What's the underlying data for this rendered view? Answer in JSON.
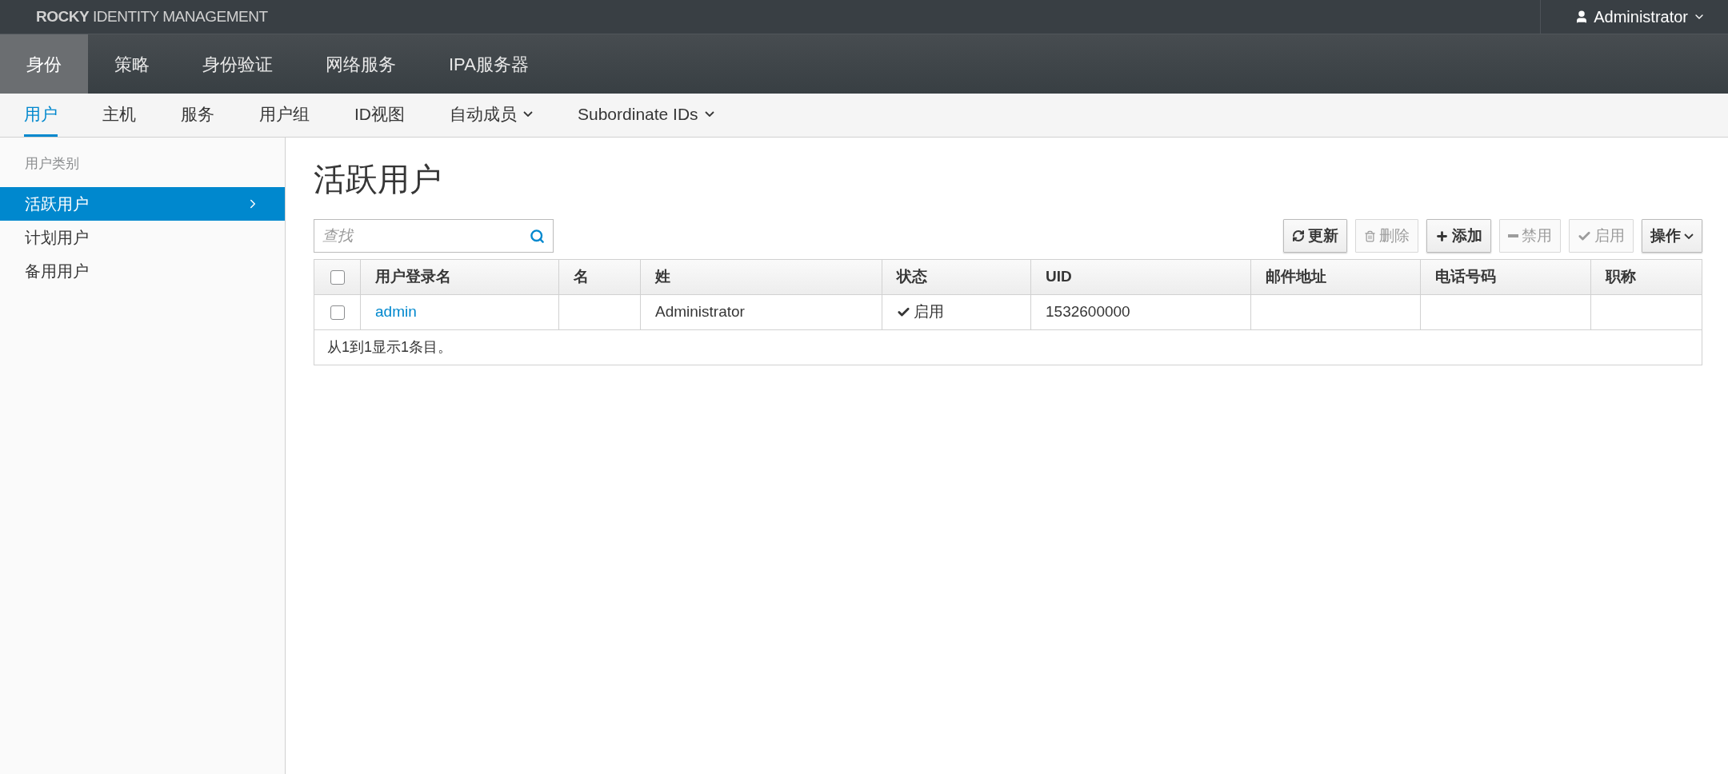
{
  "header": {
    "brand": "**ROCKY** IDENTITY MANAGEMENT",
    "user": "Administrator"
  },
  "main_nav": [
    {
      "label": "身份",
      "selected": true
    },
    {
      "label": "策略",
      "selected": false
    },
    {
      "label": "身份验证",
      "selected": false
    },
    {
      "label": "网络服务",
      "selected": false
    },
    {
      "label": "IPA服务器",
      "selected": false
    }
  ],
  "sub_nav": [
    {
      "label": "用户",
      "selected": true,
      "dropdown": false
    },
    {
      "label": "主机",
      "selected": false,
      "dropdown": false
    },
    {
      "label": "服务",
      "selected": false,
      "dropdown": false
    },
    {
      "label": "用户组",
      "selected": false,
      "dropdown": false
    },
    {
      "label": "ID视图",
      "selected": false,
      "dropdown": false
    },
    {
      "label": "自动成员",
      "selected": false,
      "dropdown": true
    },
    {
      "label": "Subordinate IDs",
      "selected": false,
      "dropdown": true
    }
  ],
  "sidebar": {
    "heading": "用户类别",
    "items": [
      {
        "label": "活跃用户",
        "selected": true
      },
      {
        "label": "计划用户",
        "selected": false
      },
      {
        "label": "备用用户",
        "selected": false
      }
    ]
  },
  "page_title": "活跃用户",
  "search": {
    "placeholder": "查找"
  },
  "toolbar": [
    {
      "label": "更新",
      "kind": "refresh",
      "disabled": false
    },
    {
      "label": "删除",
      "kind": "trash",
      "disabled": true
    },
    {
      "label": "添加",
      "kind": "plus",
      "disabled": false
    },
    {
      "label": "禁用",
      "kind": "minus",
      "disabled": true
    },
    {
      "label": "启用",
      "kind": "check",
      "disabled": true
    },
    {
      "label": "操作",
      "kind": "menu",
      "disabled": false
    }
  ],
  "table": {
    "select_all": {
      "checked": false
    },
    "columns": [
      "用户登录名",
      "名",
      "姓",
      "状态",
      "UID",
      "邮件地址",
      "电话号码",
      "职称"
    ],
    "rows": [
      {
        "checked": false,
        "cells": [
          {
            "kind": "link",
            "text": "admin"
          },
          {
            "kind": "text",
            "text": ""
          },
          {
            "kind": "text",
            "text": "Administrator"
          },
          {
            "kind": "status",
            "text": "启用"
          },
          {
            "kind": "text",
            "text": "1532600000"
          },
          {
            "kind": "text",
            "text": ""
          },
          {
            "kind": "text",
            "text": ""
          },
          {
            "kind": "text",
            "text": ""
          }
        ]
      }
    ],
    "footer": "从1到1显示1条目。"
  }
}
